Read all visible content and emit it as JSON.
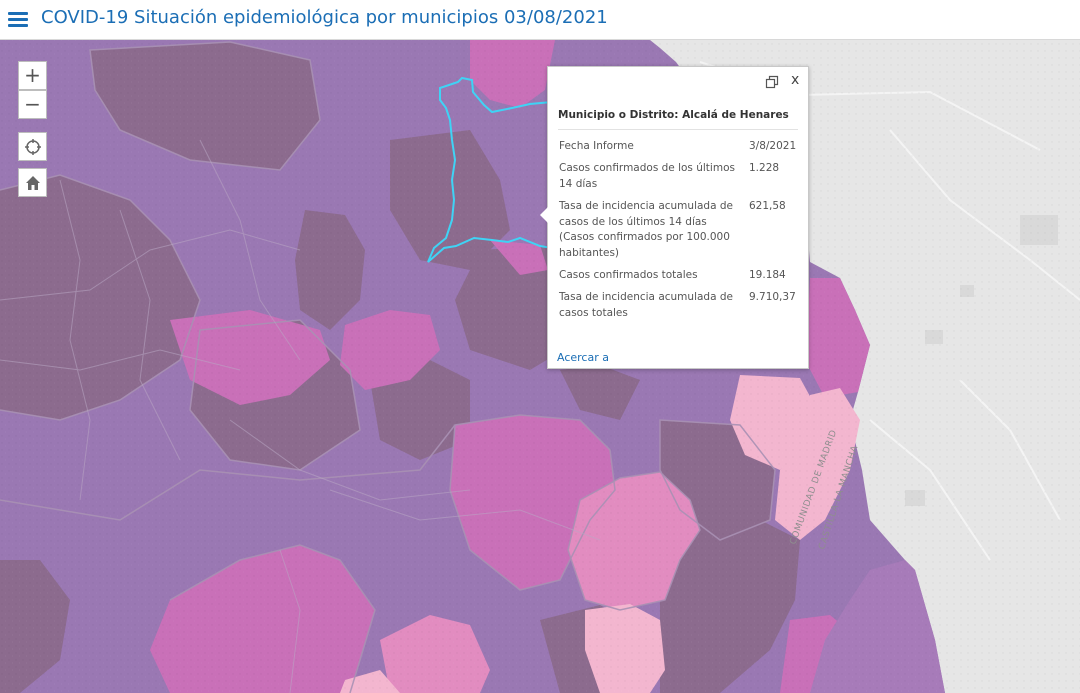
{
  "header": {
    "title": "COVID-19 Situación epidemiológica por municipios 03/08/2021",
    "menu_icon": "hamburger-menu-icon",
    "accent_color": "#1b6eb5"
  },
  "map_controls": {
    "zoom_in": "+",
    "zoom_out": "−",
    "locate_icon": "crosshair-locate-icon",
    "home_icon": "home-icon"
  },
  "map_labels": {
    "region_a": "COMUNIDAD DE MADRID",
    "region_b": "CASTILLA-LA MANCHA"
  },
  "popup": {
    "title": "Municipio o Distrito: Alcalá de Henares",
    "fields": [
      {
        "label": "Fecha Informe",
        "value": "3/8/2021"
      },
      {
        "label": "Casos confirmados de los últimos 14 días",
        "value": "1.228"
      },
      {
        "label": "Tasa de incidencia acumulada de casos de los últimos 14 días (Casos confirmados por 100.000 habitantes)",
        "value": "621,58"
      },
      {
        "label": "Casos confirmados totales",
        "value": "19.184"
      },
      {
        "label": "Tasa de incidencia acumulada de casos totales",
        "value": "9.710,37"
      }
    ],
    "zoom_link": "Acercar a",
    "close_label": "x",
    "dock_icon": "dock-popup-icon"
  },
  "colors": {
    "highlight_outline": "#3fd3f5",
    "shade_dark": "#8c6b8e",
    "shade_purple": "#9a78b3",
    "shade_magenta": "#c970b8",
    "shade_pink": "#e28cc0",
    "shade_light_pink": "#f3b6cf",
    "basemap_gray": "#e6e6e6"
  }
}
